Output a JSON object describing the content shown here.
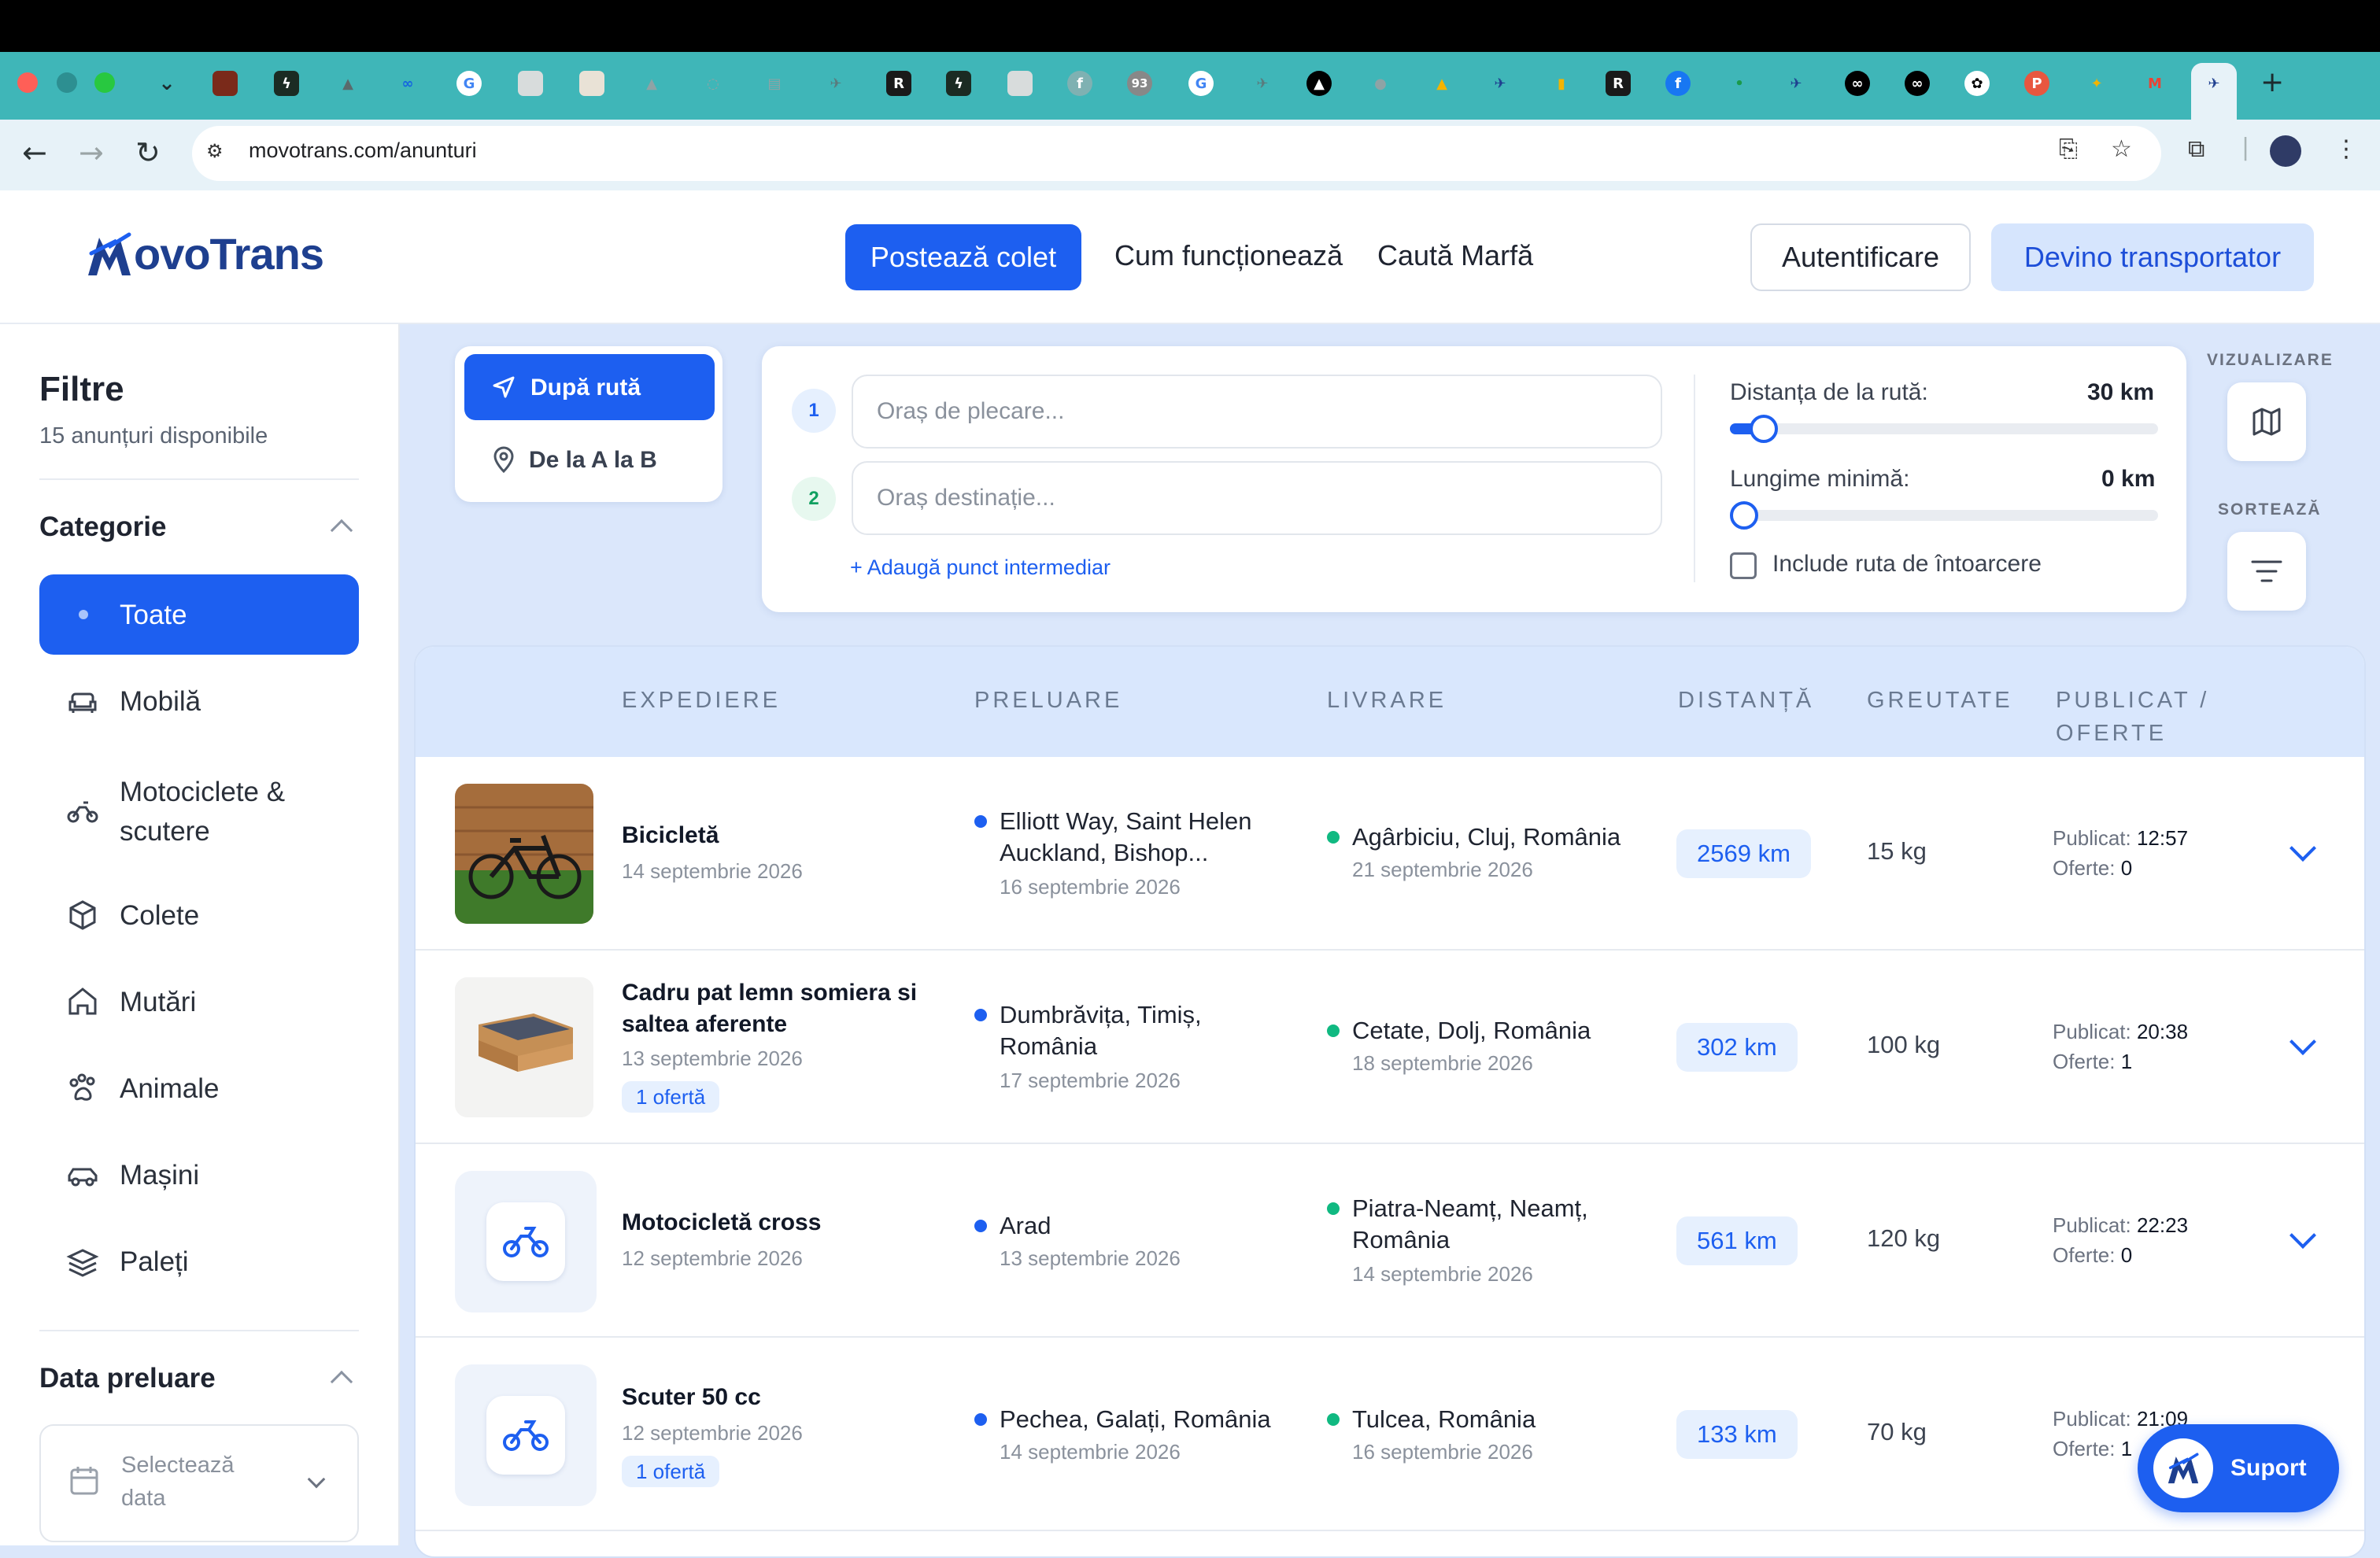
{
  "browser": {
    "url": "movotrans.com/anunturi",
    "tab_badge": "93"
  },
  "header": {
    "logo_text": "ovoTrans",
    "post_button": "Postează colet",
    "nav_how": "Cum funcționează",
    "nav_search": "Caută Marfă",
    "login_button": "Autentificare",
    "become_carrier_button": "Devino transportator"
  },
  "sidebar": {
    "title": "Filtre",
    "subtitle": "15 anunțuri disponibile",
    "category_heading": "Categorie",
    "categories": [
      {
        "label": "Toate",
        "icon": "dot-icon"
      },
      {
        "label": "Mobilă",
        "icon": "sofa-icon"
      },
      {
        "label": "Motociclete & scutere",
        "icon": "motorcycle-icon"
      },
      {
        "label": "Colete",
        "icon": "box-icon"
      },
      {
        "label": "Mutări",
        "icon": "home-icon"
      },
      {
        "label": "Animale",
        "icon": "paw-icon"
      },
      {
        "label": "Mașini",
        "icon": "car-icon"
      },
      {
        "label": "Paleți",
        "icon": "layers-icon"
      }
    ],
    "pickup_date_heading": "Data preluare",
    "date_placeholder_line1": "Selectează",
    "date_placeholder_line2": "data"
  },
  "search": {
    "mode_route": "După rută",
    "mode_ab": "De la A la B",
    "step1": "1",
    "step2": "2",
    "origin_placeholder": "Oraș de plecare...",
    "destination_placeholder": "Oraș destinație...",
    "add_waypoint": "+ Adaugă punct intermediar",
    "distance_label": "Distanța de la rută:",
    "distance_value": "30 km",
    "distance_fraction": 0.05,
    "min_length_label": "Lungime minimă:",
    "min_length_value": "0 km",
    "min_length_fraction": 0,
    "include_return": "Include ruta de întoarcere",
    "view_label": "VIZUALIZARE",
    "sort_label": "SORTEAZĂ"
  },
  "table": {
    "headers": {
      "shipment": "EXPEDIERE",
      "pickup": "PRELUARE",
      "delivery": "LIVRARE",
      "distance": "DISTANȚĂ",
      "weight": "GREUTATE",
      "published_line1": "PUBLICAT /",
      "published_line2": "OFERTE"
    },
    "published_prefix": "Publicat:",
    "offers_prefix": "Oferte:",
    "rows": [
      {
        "title_line1": "Bicicletă",
        "title_line2": "",
        "date": "14 septembrie 2026",
        "offer_badge": "",
        "pickup_line1": "Elliott Way, Saint Helen",
        "pickup_line2": "Auckland, Bishop...",
        "pickup_date": "16 septembrie 2026",
        "delivery_line1": "Agârbiciu, Cluj, România",
        "delivery_line2": "",
        "delivery_date": "21 septembrie 2026",
        "distance": "2569 km",
        "weight": "15 kg",
        "published": "12:57",
        "offers": "0"
      },
      {
        "title_line1": "Cadru pat lemn somiera si",
        "title_line2": "saltea aferente",
        "date": "13 septembrie 2026",
        "offer_badge": "1 ofertă",
        "pickup_line1": "Dumbrăvița, Timiș,",
        "pickup_line2": "România",
        "pickup_date": "17 septembrie 2026",
        "delivery_line1": "Cetate, Dolj, România",
        "delivery_line2": "",
        "delivery_date": "18 septembrie 2026",
        "distance": "302 km",
        "weight": "100 kg",
        "published": "20:38",
        "offers": "1"
      },
      {
        "title_line1": "Motocicletă cross",
        "title_line2": "",
        "date": "12 septembrie 2026",
        "offer_badge": "",
        "pickup_line1": "Arad",
        "pickup_line2": "",
        "pickup_date": "13 septembrie 2026",
        "delivery_line1": "Piatra-Neamț, Neamț,",
        "delivery_line2": "România",
        "delivery_date": "14 septembrie 2026",
        "distance": "561 km",
        "weight": "120 kg",
        "published": "22:23",
        "offers": "0"
      },
      {
        "title_line1": "Scuter 50 cc",
        "title_line2": "",
        "date": "12 septembrie 2026",
        "offer_badge": "1 ofertă",
        "pickup_line1": "Pechea, Galați, România",
        "pickup_line2": "",
        "pickup_date": "14 septembrie 2026",
        "delivery_line1": "Tulcea, România",
        "delivery_line2": "",
        "delivery_date": "16 septembrie 2026",
        "distance": "133 km",
        "weight": "70 kg",
        "published": "21:09",
        "offers": "1"
      }
    ]
  },
  "support_button": "Suport",
  "colors": {
    "primary": "#1d5ff0",
    "page_bg": "#dbe7fb",
    "pickup_dot": "#1d5ff0",
    "delivery_dot": "#10b981",
    "tab_strip": "#3fb6b8"
  }
}
